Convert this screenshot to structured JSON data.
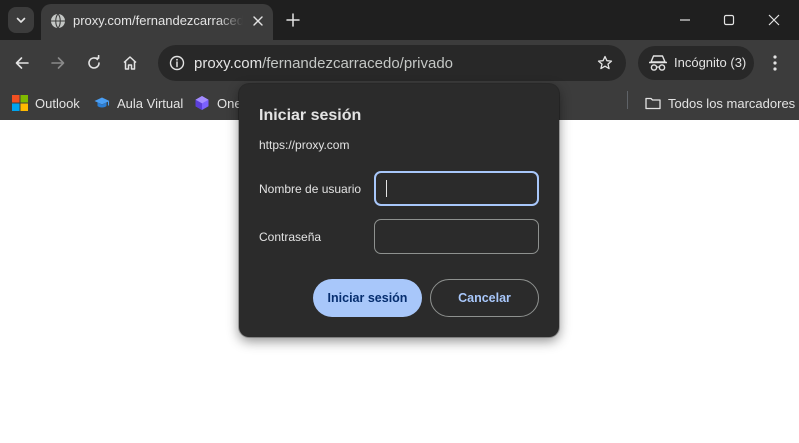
{
  "tab": {
    "title": "proxy.com/fernandezcarracedo/privado"
  },
  "toolbar": {
    "url_host": "proxy.com",
    "url_path": "/fernandezcarracedo/privado",
    "incognito_label": "Incógnito (3)"
  },
  "bookmarks": {
    "items": [
      {
        "label": "Outlook",
        "icon": "microsoft-logo-icon"
      },
      {
        "label": "Aula Virtual",
        "icon": "graduation-cap-icon"
      },
      {
        "label": "One",
        "icon": "onenote-icon"
      }
    ],
    "all_bookmarks": "Todos los marcadores"
  },
  "dialog": {
    "title": "Iniciar sesión",
    "origin": "https://proxy.com",
    "username_label": "Nombre de usuario",
    "username_value": "",
    "password_label": "Contraseña",
    "password_value": "",
    "signin_button": "Iniciar sesión",
    "cancel_button": "Cancelar"
  },
  "colors": {
    "chrome_dark": "#1f1f1f",
    "toolbar": "#3c3c3c",
    "dialog_bg": "#2b2b2b",
    "accent": "#a8c7fa"
  }
}
